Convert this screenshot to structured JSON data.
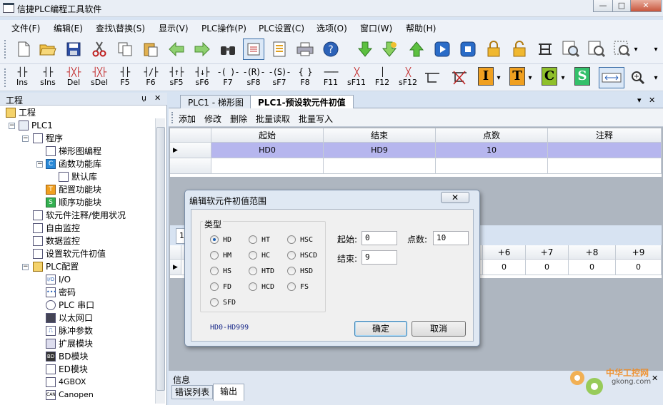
{
  "window": {
    "title": "信捷PLC编程工具软件"
  },
  "window_controls": {
    "minimize": "—",
    "maximize": "□",
    "close": "✕"
  },
  "menu": [
    "文件(F)",
    "编辑(E)",
    "查找\\替换(S)",
    "显示(V)",
    "PLC操作(P)",
    "PLC设置(C)",
    "选项(O)",
    "窗口(W)",
    "帮助(H)"
  ],
  "ladder_toolbar": [
    {
      "sym": "┤├",
      "cap": "Ins"
    },
    {
      "sym": "┤├",
      "cap": "sIns"
    },
    {
      "sym": "┤╳├",
      "cap": "Del"
    },
    {
      "sym": "┤╳├",
      "cap": "sDel"
    },
    {
      "sym": "┤├",
      "cap": "F5"
    },
    {
      "sym": "┤/├",
      "cap": "F6"
    },
    {
      "sym": "┤↑├",
      "cap": "sF5"
    },
    {
      "sym": "┤↓├",
      "cap": "sF6"
    },
    {
      "sym": "-( )-",
      "cap": "F7"
    },
    {
      "sym": "-(R)-",
      "cap": "sF8"
    },
    {
      "sym": "-(S)-",
      "cap": "sF7"
    },
    {
      "sym": "{ }",
      "cap": "F8"
    },
    {
      "sym": "───",
      "cap": "F11"
    },
    {
      "sym": "╳",
      "cap": "sF11"
    },
    {
      "sym": "│",
      "cap": "F12"
    },
    {
      "sym": "╳",
      "cap": "sF12"
    }
  ],
  "ladder_boxes": [
    {
      "label": "I",
      "bg": "#f0a020"
    },
    {
      "label": "T",
      "bg": "#f0a020"
    },
    {
      "label": "C",
      "bg": "#8fc02a"
    },
    {
      "label": "S",
      "bg": "#33c06a"
    }
  ],
  "project_panel": {
    "title": "工程",
    "pin": "ụ",
    "close": "✕",
    "items": [
      {
        "label": "工程"
      },
      {
        "label": "PLC1"
      },
      {
        "label": "程序"
      },
      {
        "label": "梯形图编程"
      },
      {
        "label": "函数功能库"
      },
      {
        "label": "默认库"
      },
      {
        "label": "配置功能块"
      },
      {
        "label": "顺序功能块"
      },
      {
        "label": "软元件注释/使用状况"
      },
      {
        "label": "自由监控"
      },
      {
        "label": "数据监控"
      },
      {
        "label": "设置软元件初值"
      },
      {
        "label": "PLC配置"
      },
      {
        "label": "I/O"
      },
      {
        "label": "密码"
      },
      {
        "label": "PLC 串口"
      },
      {
        "label": "以太网口"
      },
      {
        "label": "脉冲参数"
      },
      {
        "label": "扩展模块"
      },
      {
        "label": "BD模块"
      },
      {
        "label": "ED模块"
      },
      {
        "label": "4GBOX"
      },
      {
        "label": "Canopen"
      }
    ],
    "icon_text": {
      "func_lib": "C",
      "config_block": "T",
      "seq_block": "S",
      "io": "I/O",
      "password": "•••",
      "bd": "BD",
      "canopen": "CAN"
    }
  },
  "tabs": [
    {
      "label": "PLC1 - 梯形图"
    },
    {
      "label": "PLC1-预设软元件初值"
    }
  ],
  "tab_controls": {
    "dropdown": "▾",
    "close": "✕"
  },
  "sub_toolbar": [
    "添加",
    "修改",
    "删除",
    "批量读取",
    "批量写入"
  ],
  "range_table": {
    "headers": [
      "起始",
      "结束",
      "点数",
      "注释"
    ],
    "rows": [
      {
        "marker": "▶",
        "start": "HD0",
        "end": "HD9",
        "count": "10",
        "note": ""
      }
    ]
  },
  "value_table": {
    "tab_label": "1",
    "headers": [
      "+6",
      "+7",
      "+8",
      "+9"
    ],
    "marker": "▶",
    "values": [
      "0",
      "0",
      "0",
      "0"
    ]
  },
  "dialog": {
    "title": "编辑软元件初值范围",
    "close": "✕",
    "group_label": "类型",
    "radios": [
      {
        "label": "HD",
        "checked": true
      },
      {
        "label": "HT",
        "checked": false
      },
      {
        "label": "HSC",
        "checked": false
      },
      {
        "label": "HM",
        "checked": false
      },
      {
        "label": "HC",
        "checked": false
      },
      {
        "label": "HSCD",
        "checked": false
      },
      {
        "label": "HS",
        "checked": false
      },
      {
        "label": "HTD",
        "checked": false
      },
      {
        "label": "HSD",
        "checked": false
      },
      {
        "label": "FD",
        "checked": false
      },
      {
        "label": "HCD",
        "checked": false
      },
      {
        "label": "FS",
        "checked": false
      },
      {
        "label": "SFD",
        "checked": false
      }
    ],
    "start_label": "起始:",
    "start_value": "0",
    "count_label": "点数:",
    "count_value": "10",
    "end_label": "结束:",
    "end_value": "9",
    "range_text": "HD0-HD999",
    "ok": "确定",
    "cancel": "取消"
  },
  "info_panel": {
    "title": "信息",
    "tabs": [
      "错误列表",
      "输出"
    ],
    "close": "✕"
  },
  "watermark": {
    "line1": "中华工控网",
    "line2": "gkong.com"
  }
}
